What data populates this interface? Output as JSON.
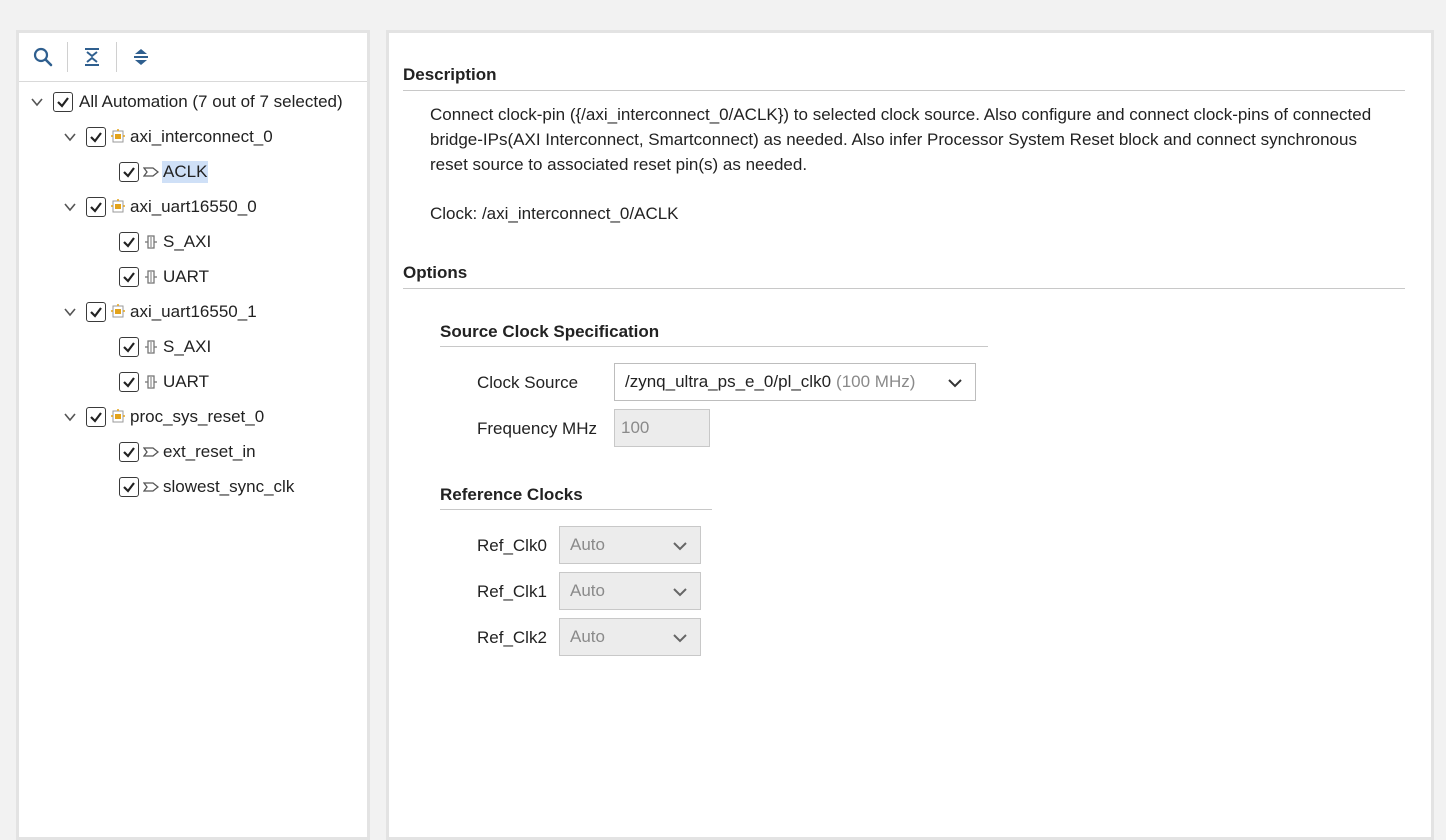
{
  "toolbar": {
    "search_icon": "search-icon",
    "collapse_icon": "collapse-all-icon",
    "expand_icon": "expand-all-icon"
  },
  "tree": {
    "root": {
      "label": "All Automation (7 out of 7 selected)",
      "checked": true
    },
    "items": [
      {
        "label": "axi_interconnect_0",
        "checked": true,
        "icon": "ip-block-icon",
        "children": [
          {
            "label": "ACLK",
            "checked": true,
            "icon": "clock-pin-icon",
            "selected": true
          }
        ]
      },
      {
        "label": "axi_uart16550_0",
        "checked": true,
        "icon": "ip-block-icon",
        "children": [
          {
            "label": "S_AXI",
            "checked": true,
            "icon": "bus-interface-icon"
          },
          {
            "label": "UART",
            "checked": true,
            "icon": "bus-interface-icon"
          }
        ]
      },
      {
        "label": "axi_uart16550_1",
        "checked": true,
        "icon": "ip-block-icon",
        "children": [
          {
            "label": "S_AXI",
            "checked": true,
            "icon": "bus-interface-icon"
          },
          {
            "label": "UART",
            "checked": true,
            "icon": "bus-interface-icon"
          }
        ]
      },
      {
        "label": "proc_sys_reset_0",
        "checked": true,
        "icon": "ip-block-icon",
        "children": [
          {
            "label": "ext_reset_in",
            "checked": true,
            "icon": "pin-icon"
          },
          {
            "label": "slowest_sync_clk",
            "checked": true,
            "icon": "pin-icon"
          }
        ]
      }
    ]
  },
  "description": {
    "heading": "Description",
    "text": "Connect clock-pin ({/axi_interconnect_0/ACLK}) to selected clock source. Also configure and connect clock-pins of connected bridge-IPs(AXI Interconnect, Smartconnect) as needed. Also infer Processor System Reset block and connect synchronous reset source to associated reset pin(s) as needed.",
    "clock_line": "Clock: /axi_interconnect_0/ACLK"
  },
  "options": {
    "heading": "Options",
    "source_clock": {
      "heading": "Source Clock Specification",
      "clock_source_label": "Clock Source",
      "clock_source_value": "/zynq_ultra_ps_e_0/pl_clk0",
      "clock_source_freq": "(100 MHz)",
      "frequency_label": "Frequency MHz",
      "frequency_value": "100"
    },
    "reference_clocks": {
      "heading": "Reference Clocks",
      "items": [
        {
          "label": "Ref_Clk0",
          "value": "Auto"
        },
        {
          "label": "Ref_Clk1",
          "value": "Auto"
        },
        {
          "label": "Ref_Clk2",
          "value": "Auto"
        }
      ]
    }
  },
  "colors": {
    "accent_ip": "#e3a31b",
    "selection": "#cfe0f7",
    "toolbar_icon": "#2f5f8f"
  }
}
